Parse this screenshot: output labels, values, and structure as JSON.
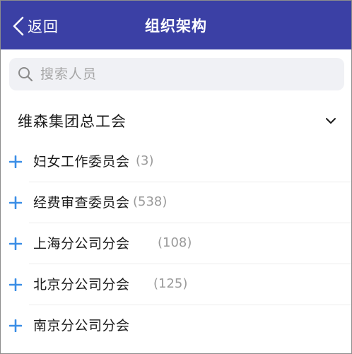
{
  "navbar": {
    "back_label": "返回",
    "title": "组织架构",
    "color": "#3b40a5"
  },
  "search": {
    "placeholder": "搜索人员",
    "value": ""
  },
  "group": {
    "title": "维森集团总工会"
  },
  "items": [
    {
      "name": "妇女工作委员会",
      "count": "(3)"
    },
    {
      "name": "经费审查委员会",
      "count": "(538)"
    },
    {
      "name": "上海分公司分会",
      "count": "(108)"
    },
    {
      "name": "北京分公司分会",
      "count": "(125)"
    },
    {
      "name": "南京分公司分会",
      "count": ""
    }
  ],
  "colors": {
    "accent": "#3b40a5",
    "plus": "#3a8ee6",
    "count": "#9a9a9a"
  }
}
